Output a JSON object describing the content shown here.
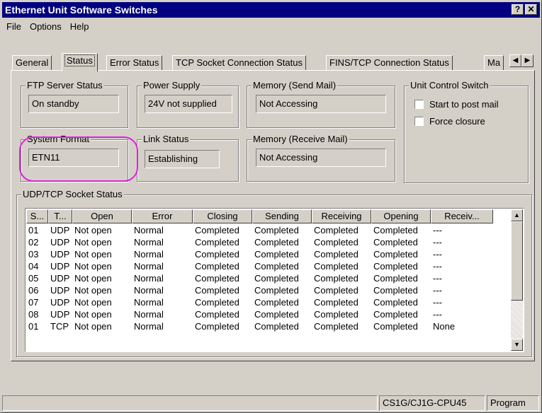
{
  "window": {
    "title": "Ethernet Unit Software Switches",
    "help_glyph": "?",
    "close_glyph": "✕"
  },
  "menu": {
    "items": [
      {
        "label": "File"
      },
      {
        "label": "Options"
      },
      {
        "label": "Help"
      }
    ]
  },
  "tabs": [
    {
      "label": "General",
      "active": false
    },
    {
      "label": "Status",
      "active": true
    },
    {
      "label": "Error Status",
      "active": false
    },
    {
      "label": "TCP Socket Connection Status",
      "active": false
    },
    {
      "label": "FINS/TCP  Connection Status",
      "active": false
    },
    {
      "label": "Ma",
      "active": false
    }
  ],
  "tab_scroll": {
    "left_glyph": "◀",
    "right_glyph": "▶"
  },
  "ftp": {
    "title": "FTP Server Status",
    "value": "On standby"
  },
  "power": {
    "title": "Power Supply",
    "value": "24V not supplied"
  },
  "mem_send": {
    "title": "Memory (Send Mail)",
    "value": "Not Accessing"
  },
  "unit_control": {
    "title": "Unit Control Switch",
    "options": [
      {
        "label": "Start to post mail",
        "checked": false
      },
      {
        "label": "Force closure",
        "checked": false
      }
    ]
  },
  "sys_format": {
    "title": "System Format",
    "value": "ETN11"
  },
  "link": {
    "title": "Link Status",
    "value": "Establishing"
  },
  "mem_recv": {
    "title": "Memory (Receive Mail)",
    "value": "Not Accessing"
  },
  "socket": {
    "title": "UDP/TCP Socket Status",
    "columns": [
      "S...",
      "T...",
      "Open",
      "Error",
      "Closing",
      "Sending",
      "Receiving",
      "Opening",
      "Receiv..."
    ],
    "rows": [
      [
        "01",
        "UDP",
        "Not open",
        "Normal",
        "Completed",
        "Completed",
        "Completed",
        "Completed",
        "---"
      ],
      [
        "02",
        "UDP",
        "Not open",
        "Normal",
        "Completed",
        "Completed",
        "Completed",
        "Completed",
        "---"
      ],
      [
        "03",
        "UDP",
        "Not open",
        "Normal",
        "Completed",
        "Completed",
        "Completed",
        "Completed",
        "---"
      ],
      [
        "04",
        "UDP",
        "Not open",
        "Normal",
        "Completed",
        "Completed",
        "Completed",
        "Completed",
        "---"
      ],
      [
        "05",
        "UDP",
        "Not open",
        "Normal",
        "Completed",
        "Completed",
        "Completed",
        "Completed",
        "---"
      ],
      [
        "06",
        "UDP",
        "Not open",
        "Normal",
        "Completed",
        "Completed",
        "Completed",
        "Completed",
        "---"
      ],
      [
        "07",
        "UDP",
        "Not open",
        "Normal",
        "Completed",
        "Completed",
        "Completed",
        "Completed",
        "---"
      ],
      [
        "08",
        "UDP",
        "Not open",
        "Normal",
        "Completed",
        "Completed",
        "Completed",
        "Completed",
        "---"
      ],
      [
        "01",
        "TCP",
        "Not open",
        "Normal",
        "Completed",
        "Completed",
        "Completed",
        "Completed",
        "None"
      ]
    ]
  },
  "statusbar": {
    "model": "CS1G/CJ1G-CPU45",
    "mode": "Program"
  },
  "colors": {
    "titlebar": "#000080",
    "face": "#d4d0c8",
    "highlight": "#e020e0"
  }
}
